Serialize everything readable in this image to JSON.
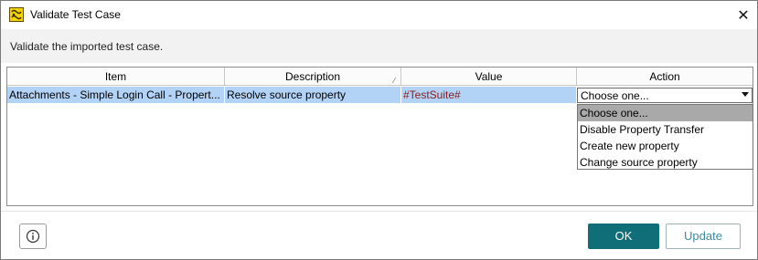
{
  "window": {
    "title": "Validate Test Case",
    "close_glyph": "✕",
    "icon": "soapui-app-icon"
  },
  "header": {
    "description": "Validate the imported test case."
  },
  "table": {
    "columns": [
      "Item",
      "Description",
      "Value",
      "Action"
    ],
    "sort_mark": "⁄",
    "rows": [
      {
        "item": "Attachments - Simple Login Call - Propert...",
        "description": "Resolve source property",
        "value": "#TestSuite#",
        "action": "Choose one..."
      }
    ]
  },
  "dropdown": {
    "options": [
      "Choose one...",
      "Disable Property Transfer",
      "Create new property",
      "Change source property"
    ],
    "selected": "Choose one..."
  },
  "footer": {
    "info_icon": "info-icon",
    "ok_label": "OK",
    "update_label": "Update"
  },
  "colors": {
    "ok_bg": "#0f6e78",
    "selection": "#b3d3f6",
    "value_text": "#8b1a1a"
  }
}
